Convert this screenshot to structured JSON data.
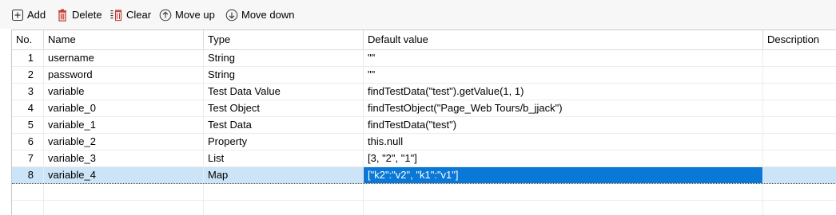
{
  "toolbar": {
    "add_label": "Add",
    "delete_label": "Delete",
    "clear_label": "Clear",
    "move_up_label": "Move up",
    "move_down_label": "Move down"
  },
  "table": {
    "headers": {
      "no": "No.",
      "name": "Name",
      "type": "Type",
      "default": "Default value",
      "description": "Description"
    },
    "rows": [
      {
        "no": "1",
        "name": "username",
        "type": "String",
        "default": "\"\"",
        "description": ""
      },
      {
        "no": "2",
        "name": "password",
        "type": "String",
        "default": "\"\"",
        "description": ""
      },
      {
        "no": "3",
        "name": "variable",
        "type": "Test Data Value",
        "default": "findTestData(\"test\").getValue(1, 1)",
        "description": ""
      },
      {
        "no": "4",
        "name": "variable_0",
        "type": "Test Object",
        "default": "findTestObject(\"Page_Web Tours/b_jjack\")",
        "description": ""
      },
      {
        "no": "5",
        "name": "variable_1",
        "type": "Test Data",
        "default": "findTestData(\"test\")",
        "description": ""
      },
      {
        "no": "6",
        "name": "variable_2",
        "type": "Property",
        "default": "this.null",
        "description": ""
      },
      {
        "no": "7",
        "name": "variable_3",
        "type": "List",
        "default": "[3, \"2\", \"1\"]",
        "description": ""
      },
      {
        "no": "8",
        "name": "variable_4",
        "type": "Map",
        "default": "[\"k2\":\"v2\", \"k1\":\"v1\"]",
        "description": ""
      }
    ],
    "selected_row": "8"
  },
  "colors": {
    "selection_row": "#cce4f7",
    "selection_cell": "#0a78d7",
    "delete_icon": "#c0392b"
  },
  "icons": {
    "add": "plus-in-square-icon",
    "delete": "trash-icon",
    "clear": "clear-list-icon",
    "move_up": "arrow-up-circle-icon",
    "move_down": "arrow-down-circle-icon"
  }
}
